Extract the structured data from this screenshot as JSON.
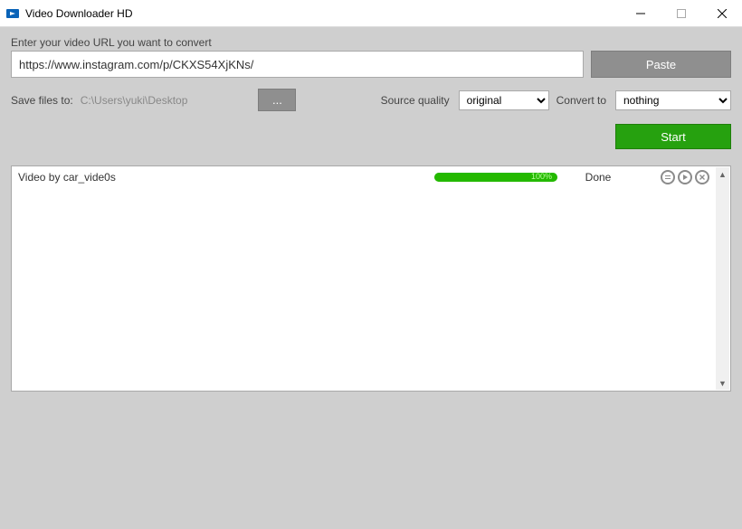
{
  "window": {
    "title": "Video Downloader HD"
  },
  "form": {
    "url_label": "Enter your video URL you want to convert",
    "url_value": "https://www.instagram.com/p/CKXS54XjKNs/",
    "paste_label": "Paste",
    "save_label": "Save files to:",
    "save_path": "C:\\Users\\yuki\\Desktop",
    "browse_label": "...",
    "source_quality_label": "Source quality",
    "quality_options": [
      "original"
    ],
    "quality_selected": "original",
    "convert_label": "Convert to",
    "convert_options": [
      "nothing"
    ],
    "convert_selected": "nothing",
    "start_label": "Start"
  },
  "list": {
    "items": [
      {
        "title": "Video by car_vide0s",
        "progress_pct": 100,
        "progress_text": "100%",
        "status": "Done"
      }
    ]
  }
}
